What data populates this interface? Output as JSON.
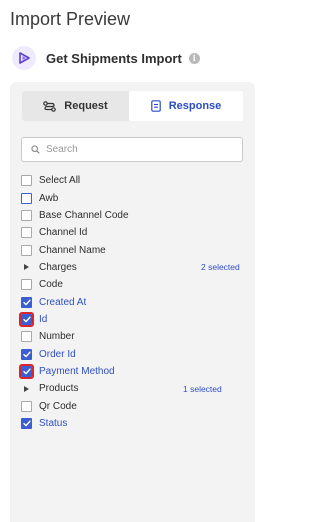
{
  "page": {
    "title": "Import Preview"
  },
  "import": {
    "name": "Get Shipments Import",
    "info_glyph": "i"
  },
  "tabs": {
    "request": "Request",
    "response": "Response",
    "active": "response"
  },
  "search": {
    "placeholder": "Search",
    "value": ""
  },
  "colors": {
    "accent": "#3b5fd0",
    "highlight": "#d9262c",
    "panel_bg": "#f3f3f3"
  },
  "fields": [
    {
      "label": "Select All",
      "type": "checkbox",
      "checked": false
    },
    {
      "label": "Awb",
      "type": "checkbox",
      "checked": false,
      "outlined": true
    },
    {
      "label": "Base Channel Code",
      "type": "checkbox",
      "checked": false
    },
    {
      "label": "Channel Id",
      "type": "checkbox",
      "checked": false
    },
    {
      "label": "Channel Name",
      "type": "checkbox",
      "checked": false
    },
    {
      "label": "Charges",
      "type": "group",
      "selected": "2 selected"
    },
    {
      "label": "Code",
      "type": "checkbox",
      "checked": false
    },
    {
      "label": "Created At",
      "type": "checkbox",
      "checked": true
    },
    {
      "label": "Id",
      "type": "checkbox",
      "checked": true,
      "highlighted": true
    },
    {
      "label": "Number",
      "type": "checkbox",
      "checked": false
    },
    {
      "label": "Order Id",
      "type": "checkbox",
      "checked": true
    },
    {
      "label": "Payment Method",
      "type": "checkbox",
      "checked": true,
      "highlighted": true
    },
    {
      "label": "Products",
      "type": "group",
      "selected": "1 selected"
    },
    {
      "label": "Qr Code",
      "type": "checkbox",
      "checked": false
    },
    {
      "label": "Status",
      "type": "checkbox",
      "checked": true
    }
  ]
}
